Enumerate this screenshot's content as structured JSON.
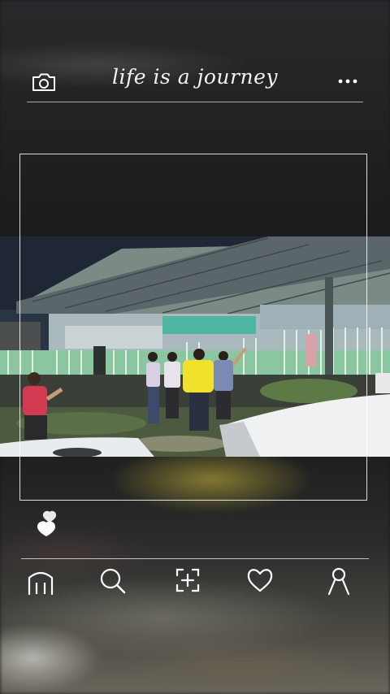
{
  "header": {
    "title": "life is a journey",
    "camera_icon": "camera-icon",
    "more_icon": "more-horizontal-icon"
  },
  "post": {
    "photo_description_icon": "photo",
    "like_icon": "heart-stack-icon"
  },
  "nav": {
    "items": [
      {
        "icon": "home-icon"
      },
      {
        "icon": "search-icon"
      },
      {
        "icon": "add-post-icon"
      },
      {
        "icon": "heart-icon"
      },
      {
        "icon": "profile-icon"
      }
    ]
  },
  "colors": {
    "icon": "#ffffff",
    "shirt_yellow": "#f2e12a",
    "shirt_red": "#d23a52",
    "fence_green": "#9ed0a6"
  }
}
